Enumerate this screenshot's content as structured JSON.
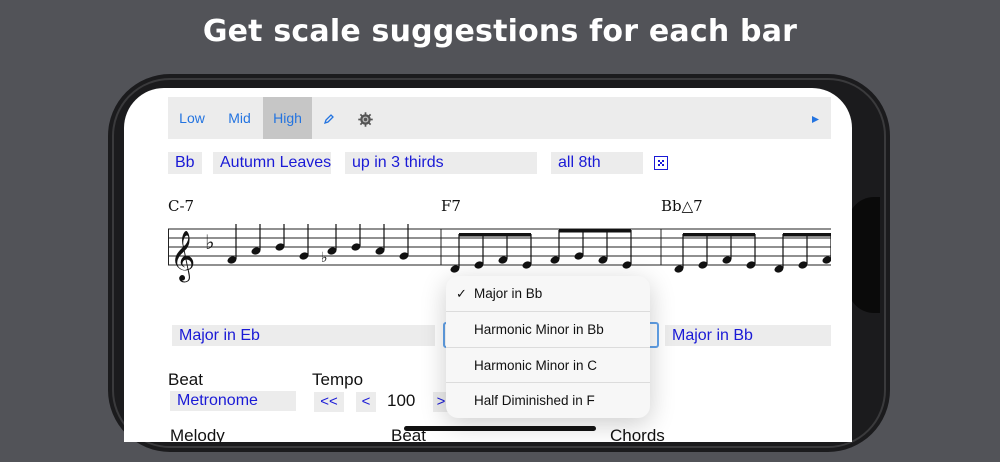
{
  "headline": "Get scale suggestions for each bar",
  "toolbar": {
    "low": "Low",
    "mid": "Mid",
    "high": "High",
    "pencil_icon": "pencil-icon",
    "gear_icon": "gear-icon",
    "play_icon": "play-icon",
    "selected": "High",
    "accent": "#2474e0"
  },
  "settings": {
    "key": "Bb",
    "tune": "Autumn Leaves",
    "pattern": "up in 3 thirds",
    "rhythm": "all 8th",
    "dice_icon": "dice-icon"
  },
  "chords": [
    "C-7",
    "F7",
    "Bb△7"
  ],
  "scales": {
    "bar1": "Major in Eb",
    "bar3": "Major in Bb"
  },
  "scale_menu": {
    "items": [
      {
        "label": "Major in Bb",
        "checked": true
      },
      {
        "label": "Harmonic Minor in Bb",
        "checked": false
      },
      {
        "label": "Harmonic Minor in C",
        "checked": false
      },
      {
        "label": "Half Diminished in F",
        "checked": false
      }
    ],
    "check_mark": "✓"
  },
  "beat": {
    "label": "Beat",
    "value": "Metronome"
  },
  "tempo": {
    "label": "Tempo",
    "dec_fast": "<<",
    "dec": "<",
    "value": "100",
    "inc": ">"
  },
  "bottom_labels": {
    "melody": "Melody",
    "beat": "Beat",
    "chords": "Chords"
  },
  "colors": {
    "background": "#525358",
    "field_text": "#1a1ad6",
    "field_bg": "#ececec"
  }
}
